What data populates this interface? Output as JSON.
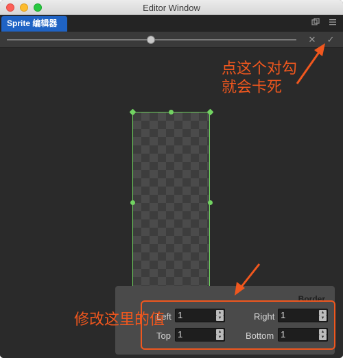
{
  "window": {
    "title": "Editor Window"
  },
  "tab": {
    "label": "Sprite 编辑器"
  },
  "tab_icons": {
    "popout": "popout-icon",
    "menu": "menu-icon"
  },
  "toolbar": {
    "zoom_level": 0.5,
    "cancel_icon": "✕",
    "confirm_icon": "✓"
  },
  "annotations": {
    "top_note_line1": "点这个对勾",
    "top_note_line2": "就会卡死",
    "bottom_note": "修改这里的值"
  },
  "border_panel": {
    "title": "Border",
    "left_label": "Left",
    "left_value": "1",
    "right_label": "Right",
    "right_value": "1",
    "top_label": "Top",
    "top_value": "1",
    "bottom_label": "Bottom",
    "bottom_value": "1"
  },
  "colors": {
    "accent": "#f0571e",
    "tab": "#1f63c4",
    "handles": "#72d362"
  }
}
